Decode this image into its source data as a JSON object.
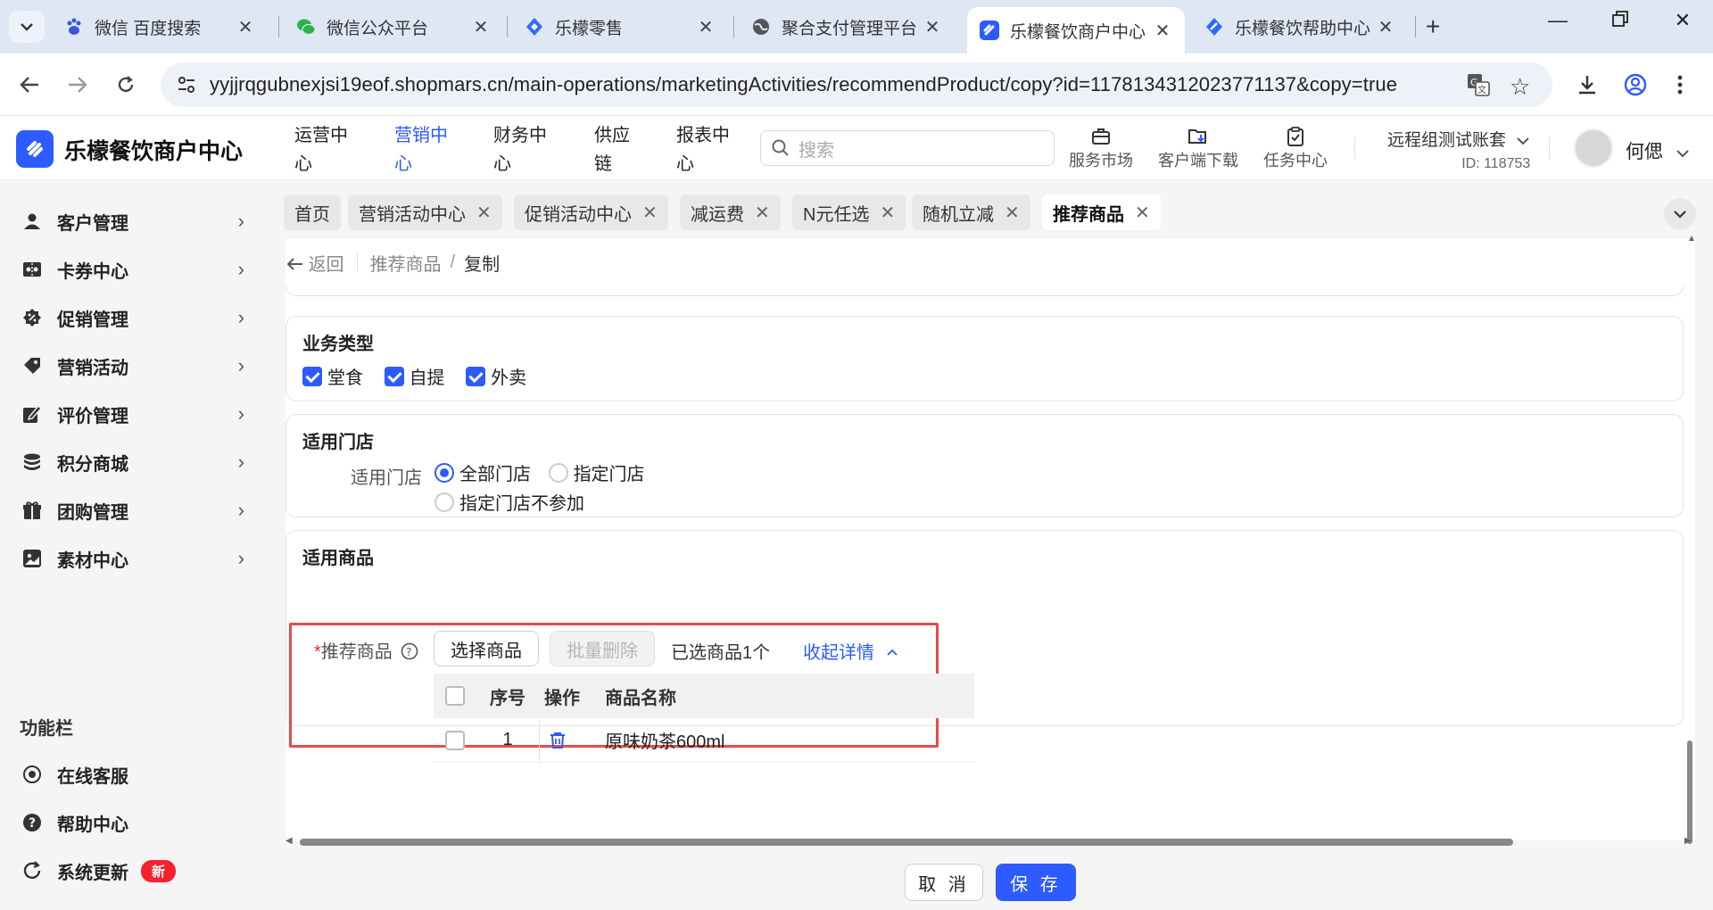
{
  "browser": {
    "tabs": [
      {
        "title": "微信 百度搜索",
        "icon": "baidu-paw-icon"
      },
      {
        "title": "微信公众平台",
        "icon": "wechat-icon"
      },
      {
        "title": "乐檬零售",
        "icon": "lemeng-retail-icon"
      },
      {
        "title": "聚合支付管理平台",
        "icon": "globe-icon"
      },
      {
        "title": "乐檬餐饮商户中心",
        "icon": "lemeng-logo-icon",
        "active": true
      },
      {
        "title": "乐檬餐饮帮助中心",
        "icon": "lemeng-help-icon"
      }
    ],
    "url": "yyjjrqgubnexjsi19eof.shopmars.cn/main-operations/marketingActivities/recommendProduct/copy?id=117813431202377113​7&copy=true"
  },
  "header": {
    "brand": "乐檬餐饮商户中心",
    "nav": [
      {
        "label": "运营中心"
      },
      {
        "label": "营销中心",
        "active": true
      },
      {
        "label": "财务中心"
      },
      {
        "label": "供应链"
      },
      {
        "label": "报表中心"
      }
    ],
    "search_placeholder": "搜索",
    "tools": [
      {
        "label": "服务市场",
        "icon": "briefcase-icon"
      },
      {
        "label": "客户端下载",
        "icon": "download-folder-icon"
      },
      {
        "label": "任务中心",
        "icon": "clipboard-check-icon"
      }
    ],
    "account_name": "远程组测试账套",
    "account_id": "ID: 118753",
    "user_name": "何偲"
  },
  "sidebar": {
    "items": [
      {
        "label": "客户管理",
        "icon": "user-icon"
      },
      {
        "label": "卡券中心",
        "icon": "ticket-icon"
      },
      {
        "label": "促销管理",
        "icon": "promo-badge-icon"
      },
      {
        "label": "营销活动",
        "icon": "tag-icon"
      },
      {
        "label": "评价管理",
        "icon": "edit-review-icon"
      },
      {
        "label": "积分商城",
        "icon": "coins-icon"
      },
      {
        "label": "团购管理",
        "icon": "gift-icon"
      },
      {
        "label": "素材中心",
        "icon": "image-icon"
      }
    ],
    "section_label": "功能栏",
    "tools": [
      {
        "label": "在线客服",
        "icon": "headset-icon"
      },
      {
        "label": "帮助中心",
        "icon": "help-circle-icon"
      },
      {
        "label": "系统更新",
        "icon": "refresh-icon",
        "badge": "新"
      }
    ]
  },
  "page_tabs": [
    {
      "label": "首页",
      "closable": false
    },
    {
      "label": "营销活动中心",
      "closable": true
    },
    {
      "label": "促销活动中心",
      "closable": true
    },
    {
      "label": "减运费",
      "closable": true
    },
    {
      "label": "N元任选",
      "closable": true
    },
    {
      "label": "随机立减",
      "closable": true
    },
    {
      "label": "推荐商品",
      "closable": true,
      "active": true
    }
  ],
  "breadcrumb": {
    "back": "返回",
    "parent": "推荐商品",
    "slash": "/",
    "current": "复制"
  },
  "business_type": {
    "title": "业务类型",
    "options": [
      {
        "label": "堂食",
        "checked": true
      },
      {
        "label": "自提",
        "checked": true
      },
      {
        "label": "外卖",
        "checked": true
      }
    ]
  },
  "stores": {
    "title": "适用门店",
    "field_label": "适用门店",
    "options": [
      {
        "label": "全部门店",
        "selected": true
      },
      {
        "label": "指定门店",
        "selected": false
      },
      {
        "label": "指定门店不参加",
        "selected": false
      }
    ]
  },
  "products": {
    "title": "适用商品",
    "required_mark": "*",
    "field_label": "推荐商品",
    "select_button": "选择商品",
    "batch_delete_button": "批量删除",
    "selected_count": "已选商品1个",
    "collapse_link": "收起详情",
    "columns": [
      "序号",
      "操作",
      "商品名称"
    ],
    "rows": [
      {
        "seq": "1",
        "name": "原味奶茶600ml"
      }
    ]
  },
  "footer": {
    "cancel": "取 消",
    "save": "保 存"
  },
  "colors": {
    "accent": "#2d5bff",
    "highlight_border": "#e84a4a",
    "badge_red": "#f5222d"
  }
}
